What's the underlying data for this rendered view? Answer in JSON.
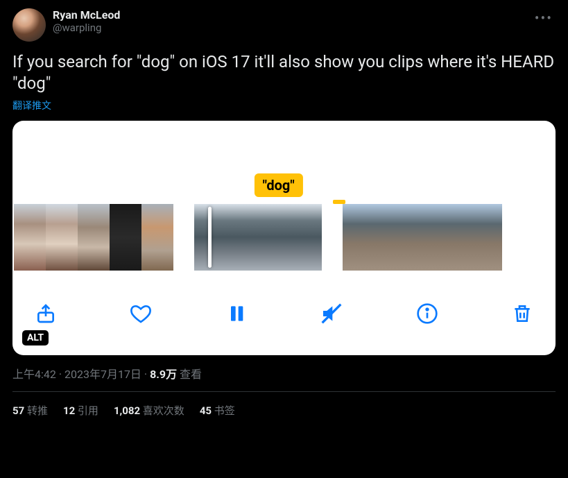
{
  "author": {
    "display_name": "Ryan McLeod",
    "username": "@warpling"
  },
  "tweet_text": "If you search for \"dog\" on iOS 17 it'll also show you clips where it's HEARD \"dog\"",
  "translate_label": "翻译推文",
  "media": {
    "label": "\"dog\"",
    "alt_badge": "ALT"
  },
  "meta": {
    "time": "上午4:42",
    "date": "2023年7月17日",
    "views_count": "8.9万",
    "views_label": "查看"
  },
  "stats": {
    "retweets_count": "57",
    "retweets_label": "转推",
    "quotes_count": "12",
    "quotes_label": "引用",
    "likes_count": "1,082",
    "likes_label": "喜欢次数",
    "bookmarks_count": "45",
    "bookmarks_label": "书签"
  }
}
